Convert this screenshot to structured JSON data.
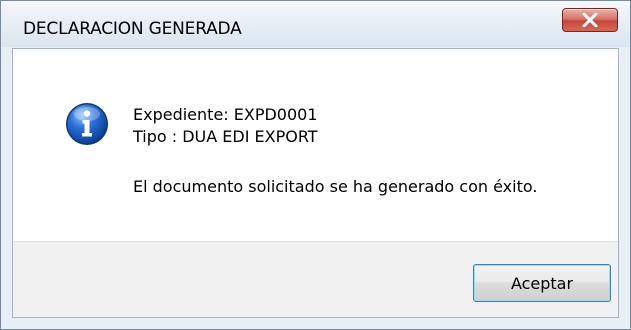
{
  "window": {
    "title": "DECLARACION GENERADA",
    "close_icon": "close-icon"
  },
  "message": {
    "icon": "information-icon",
    "expediente": "Expediente: EXPD0001",
    "tipo": "Tipo : DUA EDI EXPORT",
    "result": "El documento solicitado se ha generado con éxito."
  },
  "buttons": {
    "ok_label": "Aceptar"
  }
}
